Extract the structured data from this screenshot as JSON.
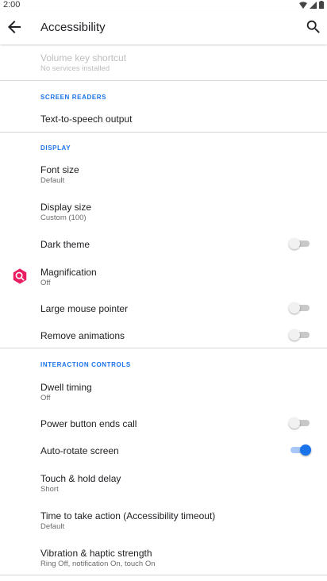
{
  "status_bar": {
    "time": "2:00"
  },
  "app_bar": {
    "title": "Accessibility"
  },
  "items": {
    "volume_key_shortcut": {
      "title": "Volume key shortcut",
      "subtitle": "No services installed"
    },
    "screen_readers_header": "SCREEN READERS",
    "tts_output": {
      "title": "Text-to-speech output"
    },
    "display_header": "DISPLAY",
    "font_size": {
      "title": "Font size",
      "subtitle": "Default"
    },
    "display_size": {
      "title": "Display size",
      "subtitle": "Custom (100)"
    },
    "dark_theme": {
      "title": "Dark theme",
      "enabled": false
    },
    "magnification": {
      "title": "Magnification",
      "subtitle": "Off"
    },
    "large_mouse_pointer": {
      "title": "Large mouse pointer",
      "enabled": false
    },
    "remove_animations": {
      "title": "Remove animations",
      "enabled": false
    },
    "interaction_header": "INTERACTION CONTROLS",
    "dwell_timing": {
      "title": "Dwell timing",
      "subtitle": "Off"
    },
    "power_button_ends_call": {
      "title": "Power button ends call",
      "enabled": false
    },
    "auto_rotate_screen": {
      "title": "Auto-rotate screen",
      "enabled": true
    },
    "touch_hold_delay": {
      "title": "Touch & hold delay",
      "subtitle": "Short"
    },
    "time_to_take_action": {
      "title": "Time to take action (Accessibility timeout)",
      "subtitle": "Default"
    },
    "vibration_haptic": {
      "title": "Vibration & haptic strength",
      "subtitle": "Ring Off, notification On, touch On"
    }
  },
  "colors": {
    "accent": "#1a73e8",
    "magnification_icon": "#e91e63"
  }
}
